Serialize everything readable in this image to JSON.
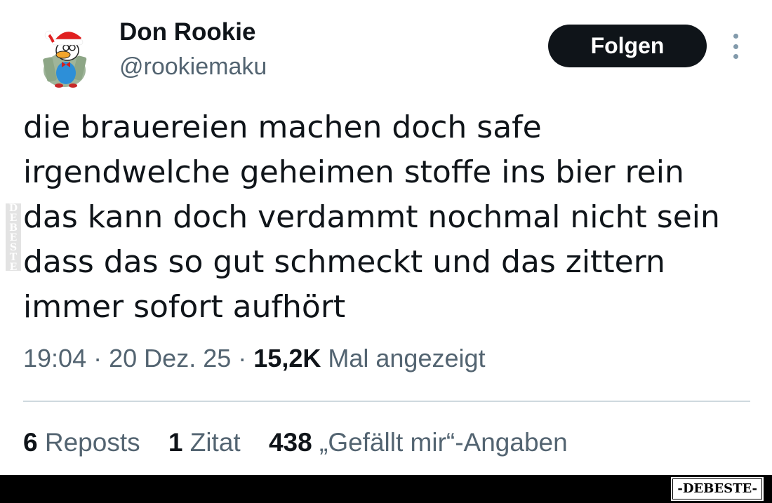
{
  "author": {
    "display_name": "Don Rookie",
    "handle": "@rookiemaku"
  },
  "follow_label": "Folgen",
  "tweet": {
    "lines": [
      "die brauereien machen doch safe",
      "irgendwelche geheimen stoffe ins bier rein",
      "das kann doch verdammt nochmal nicht sein",
      "dass das so gut schmeckt und das zittern",
      "immer sofort aufhört"
    ]
  },
  "meta": {
    "time": "19:04",
    "sep1": "·",
    "date": "20 Dez. 25",
    "sep2": "·",
    "views_count": "15,2K",
    "views_label": "Mal angezeigt"
  },
  "stats": {
    "reposts_count": "6",
    "reposts_label": "Reposts",
    "quotes_count": "1",
    "quotes_label": "Zitat",
    "likes_count": "438",
    "likes_label": "„Gefällt mir“-Angaben"
  },
  "watermarks": {
    "side": "DEBESTE",
    "bottom": "-DEBESTE-"
  },
  "icons": {
    "avatar": "santa-duck-avatar",
    "more": "more-vertical-icon"
  },
  "colors": {
    "text_primary": "#0f1419",
    "text_secondary": "#536471",
    "follow_bg": "#0f1419",
    "divider": "#cfd9de"
  }
}
